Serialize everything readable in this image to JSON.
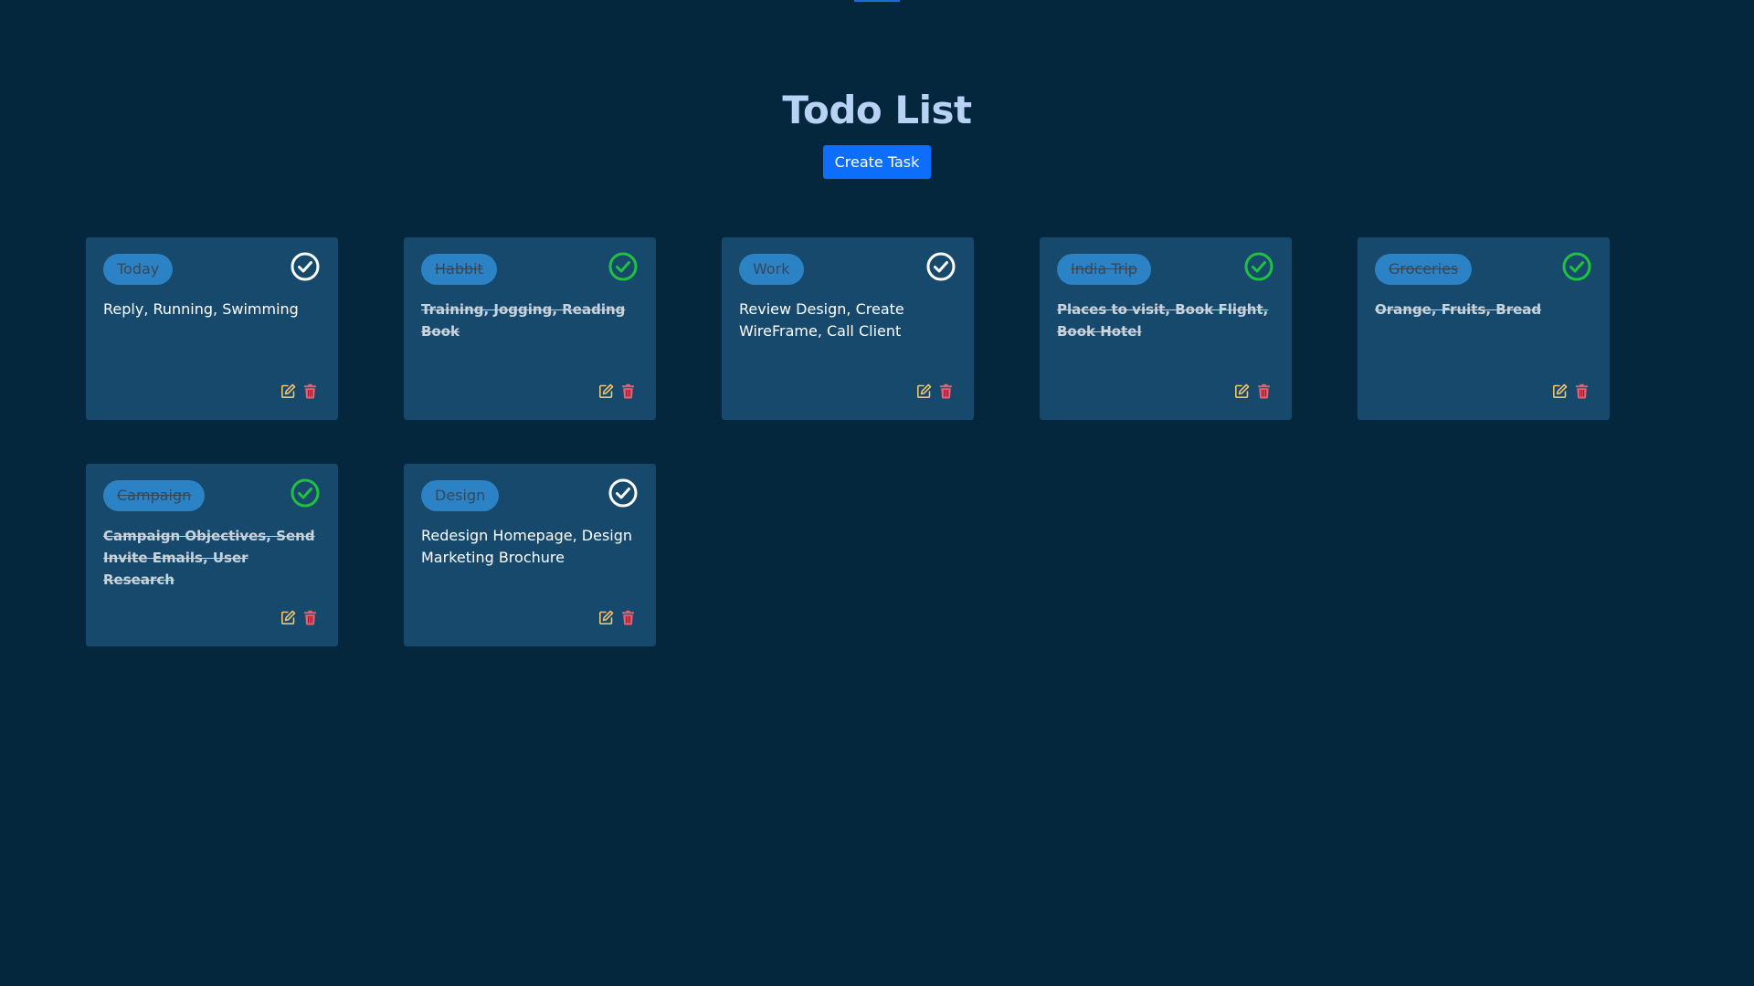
{
  "header": {
    "title": "Todo List",
    "create_button": "Create Task"
  },
  "colors": {
    "background": "#04273d",
    "card": "#17496d",
    "tag": "#2b82c4",
    "accent": "#0d6efd",
    "title": "#b8d2f6",
    "done_check": "#21c13f",
    "edit_icon": "#f0c46c",
    "delete_icon": "#f05a6a"
  },
  "tasks": [
    {
      "tag": "Today",
      "description": "Reply, Running, Swimming",
      "completed": false
    },
    {
      "tag": "Habbit",
      "description": "Training, Jogging, Reading Book",
      "completed": true
    },
    {
      "tag": "Work",
      "description": "Review Design, Create WireFrame, Call Client",
      "completed": false
    },
    {
      "tag": "India Trip",
      "description": "Places to visit, Book Flight, Book Hotel",
      "completed": true
    },
    {
      "tag": "Groceries",
      "description": "Orange, Fruits, Bread",
      "completed": true
    },
    {
      "tag": "Campaign",
      "description": "Campaign Objectives, Send Invite Emails, User Research",
      "completed": true
    },
    {
      "tag": "Design",
      "description": "Redesign Homepage, Design Marketing Brochure",
      "completed": false
    }
  ],
  "icons": {
    "check": "check-circle-icon",
    "edit": "edit-icon",
    "delete": "trash-icon"
  }
}
